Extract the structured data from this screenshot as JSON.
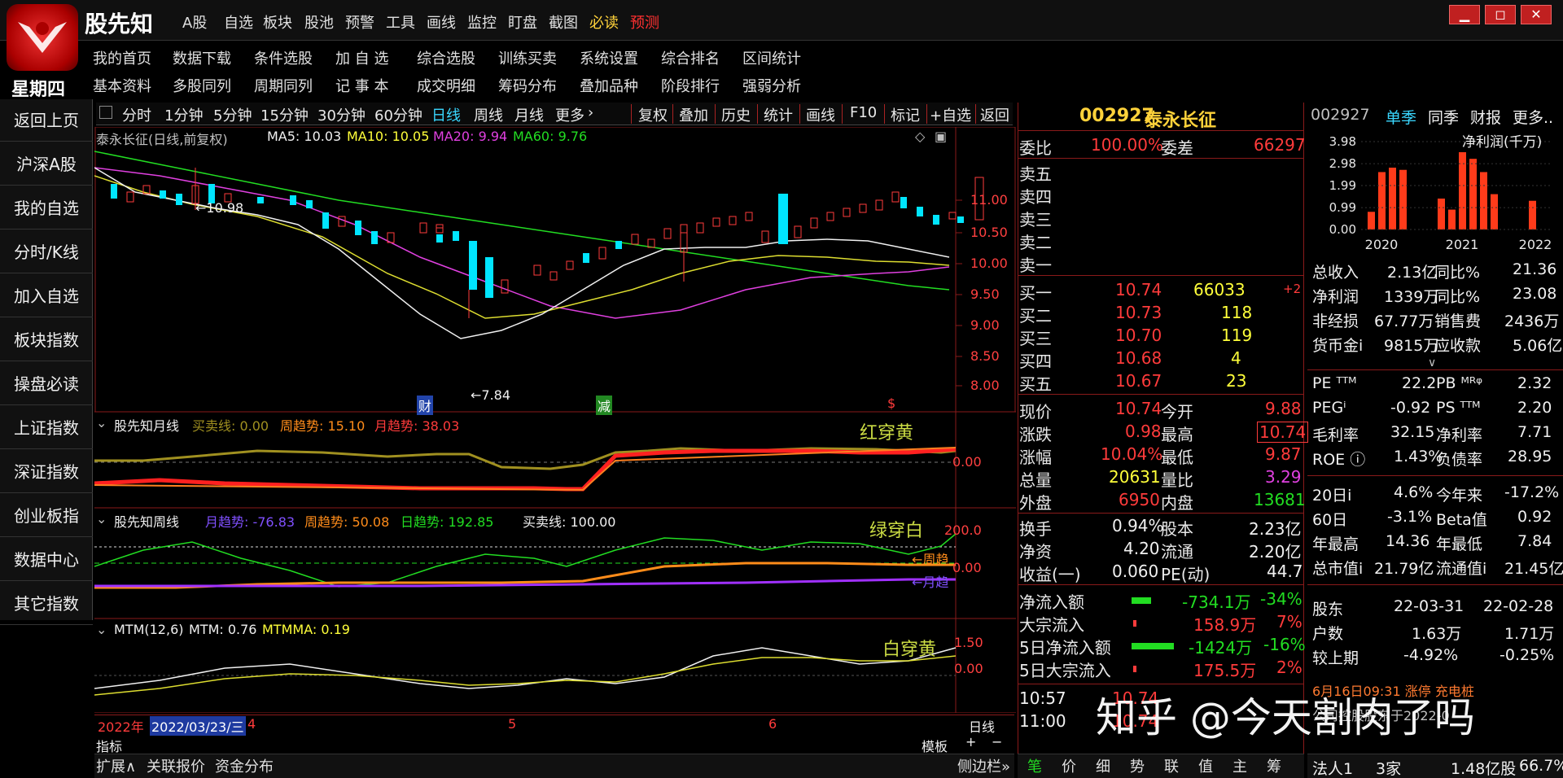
{
  "app": {
    "name": "股先知",
    "menu": [
      "A股",
      "自选",
      "板块",
      "股池",
      "预警",
      "工具",
      "画线",
      "监控",
      "盯盘",
      "截图",
      "必读",
      "预测"
    ],
    "submenu1": [
      "我的首页",
      "数据下载",
      "条件选股",
      "加 自 选",
      "综合选股",
      "训练买卖",
      "系统设置",
      "综合排名",
      "区间统计"
    ],
    "submenu2": [
      "基本资料",
      "多股同列",
      "周期同列",
      "记 事 本",
      "成交明细",
      "筹码分布",
      "叠加品种",
      "阶段排行",
      "强弱分析"
    ],
    "weekday": "星期四"
  },
  "sidebar": [
    "返回上页",
    "沪深A股",
    "我的自选",
    "分时/K线",
    "加入自选",
    "板块指数",
    "操盘必读",
    "上证指数",
    "深证指数",
    "创业板指",
    "数据中心",
    "其它指数"
  ],
  "toolbar": {
    "periods": [
      "分时",
      "1分钟",
      "5分钟",
      "15分钟",
      "30分钟",
      "60分钟",
      "日线",
      "周线",
      "月线",
      "更多"
    ],
    "active": "日线",
    "actions": [
      "复权",
      "叠加",
      "历史",
      "统计",
      "画线",
      "F10",
      "标记",
      "+自选",
      "返回"
    ]
  },
  "main_chart": {
    "title": "泰永长征(日线,前复权)",
    "ma_labels": [
      "MA5: 10.03",
      "MA10: 10.05",
      "MA20: 9.94",
      "MA60: 9.76"
    ],
    "high_mark": "10.98",
    "low_mark": "7.84",
    "y_ticks": [
      "11.00",
      "10.50",
      "10.00",
      "9.50",
      "9.00",
      "8.50",
      "8.00"
    ],
    "markers": [
      "财",
      "减",
      "$"
    ]
  },
  "panel2": {
    "title": "股先知月线",
    "labels": [
      "买卖线: 0.00",
      "周趋势: 15.10",
      "月趋势: 38.03"
    ],
    "note": "红穿黄",
    "y_tick": "0.00"
  },
  "panel3": {
    "title": "股先知周线",
    "labels": [
      "月趋势: -76.83",
      "周趋势: 50.08",
      "日趋势: 192.85",
      "买卖线: 100.00"
    ],
    "note": "绿穿白",
    "y_ticks": [
      "200.0",
      "0.00"
    ],
    "arrows": [
      "←周趋",
      "←月趋"
    ]
  },
  "panel4": {
    "title": "MTM(12,6)",
    "labels": [
      "MTM: 0.76",
      "MTMMA: 0.19"
    ],
    "note": "白穿黄",
    "y_ticks": [
      "1.50",
      "0.00"
    ]
  },
  "timeline": {
    "year": "2022年",
    "date": "2022/03/23/三",
    "months": [
      "4",
      "5",
      "6"
    ],
    "period": "日线",
    "indicator": "指标",
    "template": "模板",
    "plus": "+",
    "minus": "−",
    "bottom_tabs": [
      "扩展∧",
      "关联报价",
      "资金分布"
    ],
    "sidebar_toggle": "侧边栏»"
  },
  "quote": {
    "code": "002927",
    "name": "泰永长征",
    "weibi_label": "委比",
    "weibi": "100.00%",
    "weicha_label": "委差",
    "weicha": "66297",
    "sells": [
      "卖五",
      "卖四",
      "卖三",
      "卖二",
      "卖一"
    ],
    "buys": [
      {
        "label": "买一",
        "price": "10.74",
        "vol": "66033",
        "chg": "+2"
      },
      {
        "label": "买二",
        "price": "10.73",
        "vol": "118",
        "chg": ""
      },
      {
        "label": "买三",
        "price": "10.70",
        "vol": "119",
        "chg": ""
      },
      {
        "label": "买四",
        "price": "10.68",
        "vol": "4",
        "chg": ""
      },
      {
        "label": "买五",
        "price": "10.67",
        "vol": "23",
        "chg": ""
      }
    ],
    "stats": [
      {
        "l1": "现价",
        "v1": "10.74",
        "l2": "今开",
        "v2": "9.88"
      },
      {
        "l1": "涨跌",
        "v1": "0.98",
        "l2": "最高",
        "v2": "10.74"
      },
      {
        "l1": "涨幅",
        "v1": "10.04%",
        "l2": "最低",
        "v2": "9.87"
      },
      {
        "l1": "总量",
        "v1": "20631",
        "l2": "量比",
        "v2": "3.29"
      },
      {
        "l1": "外盘",
        "v1": "6950",
        "l2": "内盘",
        "v2": "13681"
      }
    ],
    "stats2": [
      {
        "l1": "换手",
        "v1": "0.94%",
        "l2": "股本",
        "v2": "2.23亿"
      },
      {
        "l1": "净资",
        "v1": "4.20",
        "l2": "流通",
        "v2": "2.20亿"
      },
      {
        "l1": "收益(一)",
        "v1": "0.060",
        "l2": "PE(动)",
        "v2": "44.7"
      }
    ],
    "flows": [
      {
        "label": "净流入额",
        "value": "-734.1万",
        "pct": "-34%"
      },
      {
        "label": "大宗流入",
        "value": "158.9万",
        "pct": "7%"
      },
      {
        "label": "5日净流入额",
        "value": "-1424万",
        "pct": "-16%"
      },
      {
        "label": "5日大宗流入",
        "value": "175.5万",
        "pct": "2%"
      }
    ],
    "ticks": [
      {
        "time": "10:57",
        "price": "10.74"
      },
      {
        "time": "11:00",
        "price": "10.74"
      }
    ],
    "bottom_tabs": [
      "笔",
      "价",
      "细",
      "势",
      "联",
      "值",
      "主",
      "筹"
    ]
  },
  "financials": {
    "code": "002927",
    "tabs": [
      "单季",
      "同季",
      "财报",
      "更多.."
    ],
    "chart_title": "净利润(千万)",
    "footer_note": "6月16日09:31 涨停 充电桩",
    "footer_note2": "公司控股股东于2022-0",
    "holder_label": "法人1",
    "holder_count": "3家",
    "holder_value": "1.48亿股",
    "holder_pct": "66.7%",
    "rows": [
      {
        "l1": "总收入",
        "v1": "2.13亿",
        "l2": "同比%",
        "v2": "21.36"
      },
      {
        "l1": "净利润",
        "v1": "1339万",
        "l2": "同比%",
        "v2": "23.08"
      },
      {
        "l1": "非经损",
        "v1": "67.77万",
        "l2": "销售费",
        "v2": "2436万"
      },
      {
        "l1": "货币金i",
        "v1": "9815万",
        "l2": "应收款",
        "v2": "5.06亿"
      }
    ],
    "rows2": [
      {
        "l1": "PE ᵀᵀᴹ",
        "v1": "22.2",
        "l2": "PB ᴹᴿᵠ",
        "v2": "2.32"
      },
      {
        "l1": "PEGⁱ",
        "v1": "-0.92",
        "l2": "PS ᵀᵀᴹ",
        "v2": "2.20"
      },
      {
        "l1": "毛利率",
        "v1": "32.15",
        "l2": "净利率",
        "v2": "7.71"
      },
      {
        "l1": "ROE ⓘ",
        "v1": "1.43%",
        "l2": "负债率",
        "v2": "28.95"
      }
    ],
    "rows3": [
      {
        "l1": "20日i",
        "v1": "4.6%",
        "l2": "今年来",
        "v2": "-17.2%"
      },
      {
        "l1": "60日",
        "v1": "-3.1%",
        "l2": "Beta值",
        "v2": "0.92"
      },
      {
        "l1": "年最高",
        "v1": "14.36",
        "l2": "年最低",
        "v2": "7.84"
      },
      {
        "l1": "总市值i",
        "v1": "21.79亿",
        "l2": "流通值i",
        "v2": "21.45亿"
      }
    ],
    "holders": [
      {
        "l1": "股东",
        "v1": "22-03-31",
        "v2": "22-02-28"
      },
      {
        "l1": "户数",
        "v1": "1.63万",
        "v2": "1.71万"
      },
      {
        "l1": "较上期",
        "v1": "-4.92%",
        "v2": "-0.25%"
      }
    ]
  },
  "chart_data": {
    "type": "bar",
    "title": "净利润(千万)",
    "categories": [
      "2020",
      "2021",
      "2022"
    ],
    "y_ticks": [
      "3.98",
      "2.98",
      "1.99",
      "0.99",
      "0.00"
    ],
    "ylim": [
      0,
      3.98
    ],
    "values": [
      0.8,
      2.6,
      2.8,
      2.7,
      1.4,
      0.9,
      3.5,
      3.2,
      2.6,
      1.6,
      1.3
    ]
  },
  "watermark": "知乎 @今天割肉了吗"
}
